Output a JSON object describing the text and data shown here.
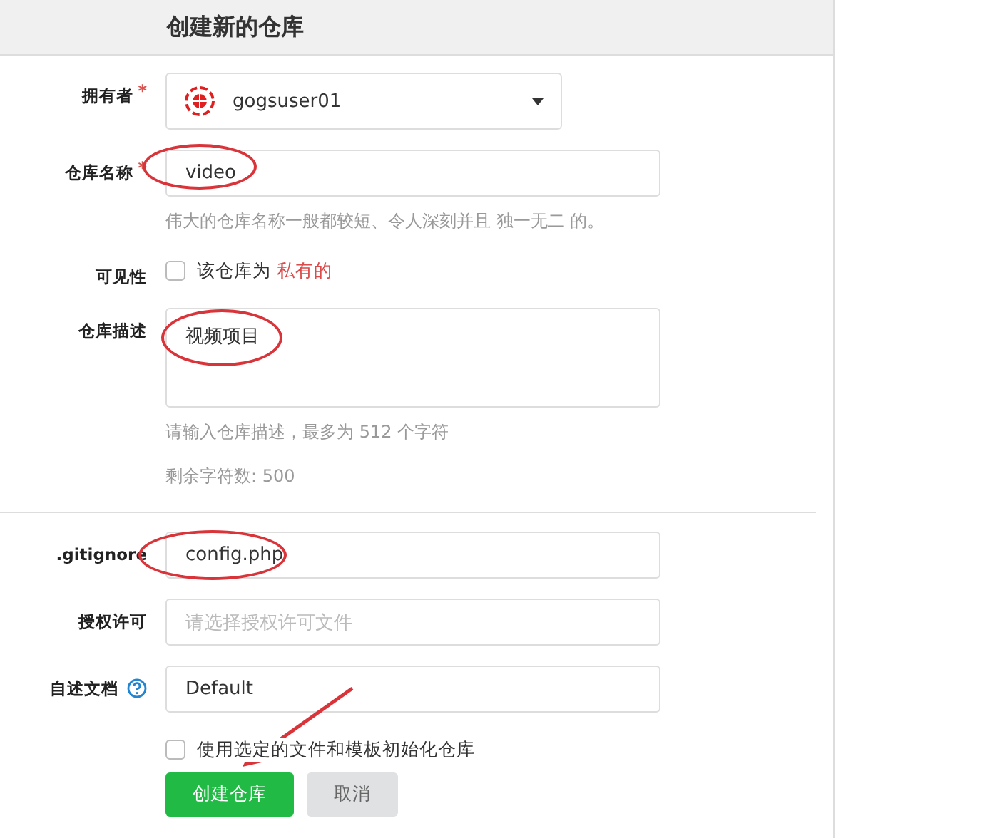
{
  "title": "创建新的仓库",
  "sections": [
    {
      "fields": [
        {
          "kind": "select",
          "label": "拥有者",
          "required_mark": "*",
          "value": "gogsuser01"
        },
        {
          "kind": "input",
          "label": "仓库名称",
          "required_mark": "*",
          "value": "video",
          "circled": true,
          "help": "伟大的仓库名称一般都较短、令人深刻并且 独一无二 的。"
        },
        {
          "kind": "checkbox",
          "label": "可见性",
          "checked": false,
          "text": "该仓库为",
          "emphasis": "私有的"
        },
        {
          "kind": "textarea",
          "label": "仓库描述",
          "value": "视频项目",
          "circled": true,
          "help": "请输入仓库描述，最多为 512 个字符",
          "remaining": "剩余字符数: 500"
        }
      ]
    },
    {
      "fields": [
        {
          "kind": "input",
          "label": ".gitignore",
          "value": "config.php",
          "circled": true
        },
        {
          "kind": "input",
          "label": "授权许可",
          "placeholder": "请选择授权许可文件",
          "circled": false
        },
        {
          "kind": "input",
          "label": "自述文档",
          "value": "Default",
          "circled": false,
          "has_help": true
        },
        {
          "kind": "checkbox",
          "checked": false,
          "text": "使用选定的文件和模板初始化仓库"
        }
      ]
    }
  ],
  "buttons": [
    {
      "kind": "primary",
      "label": "创建仓库",
      "arrow": true
    },
    {
      "kind": "secondary",
      "label": "取消"
    }
  ]
}
